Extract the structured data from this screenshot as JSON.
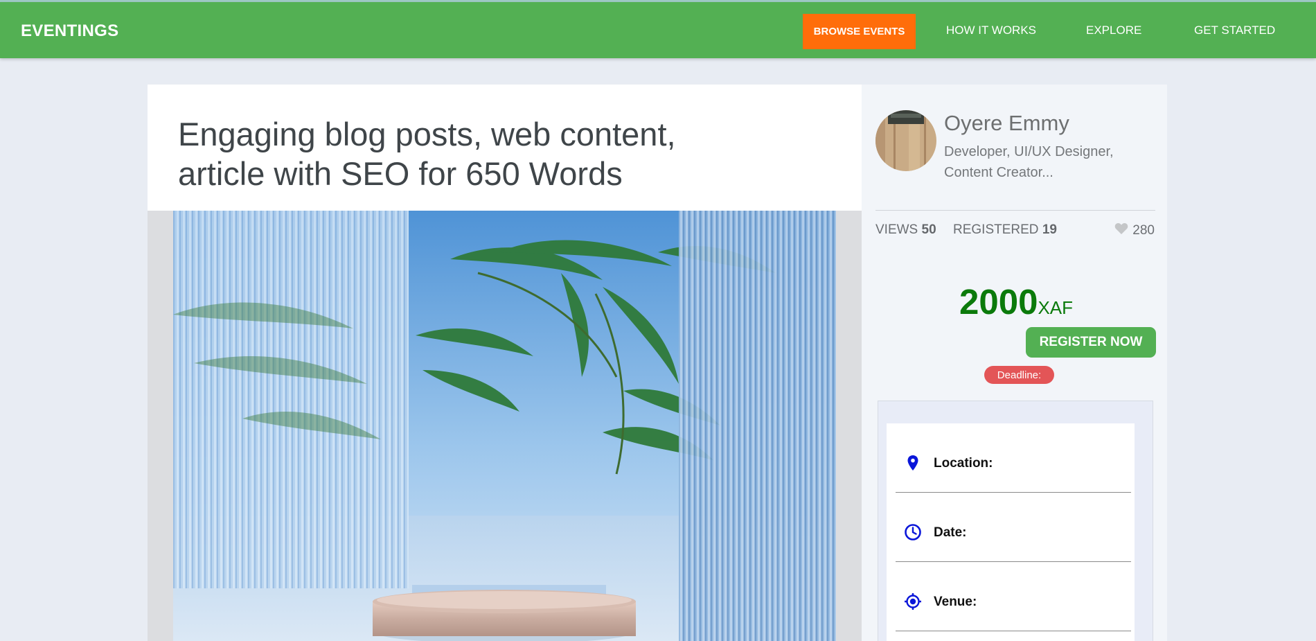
{
  "brand": "EVENTINGS",
  "nav": {
    "browse": "BROWSE EVENTS",
    "how": "HOW IT WORKS",
    "explore": "EXPLORE",
    "start": "GET STARTED"
  },
  "event": {
    "title": "Engaging blog posts, web content, article with SEO for 650 Words"
  },
  "author": {
    "name": "Oyere Emmy",
    "bio": "Developer, UI/UX Designer, Content Creator..."
  },
  "stats": {
    "views_label": "VIEWS",
    "views": "50",
    "registered_label": "REGISTERED",
    "registered": "19",
    "likes": "280"
  },
  "price": {
    "amount": "2000",
    "currency": "XAF"
  },
  "actions": {
    "register": "REGISTER NOW"
  },
  "deadline_label": "Deadline:",
  "details": {
    "location_label": "Location:",
    "date_label": "Date:",
    "venue_label": "Venue:"
  },
  "colors": {
    "navbar": "#53b053",
    "browse_button": "#ff6d0a",
    "price": "#0b7a0b",
    "deadline_badge": "#e35557",
    "detail_icons": "#0a16d9"
  }
}
